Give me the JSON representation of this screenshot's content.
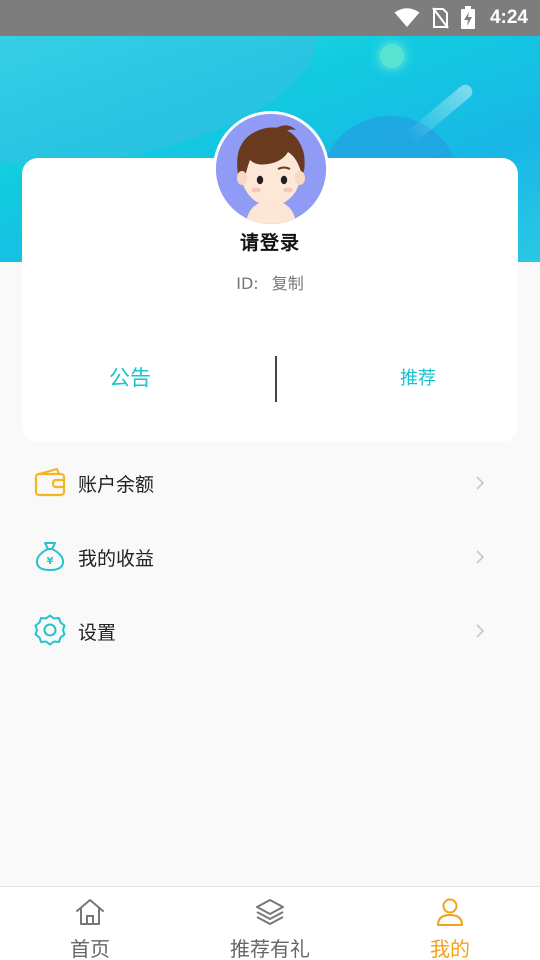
{
  "status_bar": {
    "time": "4:24"
  },
  "profile": {
    "login_prompt": "请登录",
    "id_label": "ID:",
    "copy_label": "复制"
  },
  "card_actions": {
    "notice_label": "公告",
    "recommend_label": "推荐"
  },
  "menu": {
    "items": [
      {
        "label": "账户余额",
        "icon": "wallet-icon"
      },
      {
        "label": "我的收益",
        "icon": "money-bag-icon"
      },
      {
        "label": "设置",
        "icon": "settings-gear-icon"
      }
    ]
  },
  "bottom_nav": {
    "items": [
      {
        "label": "首页",
        "icon": "home-icon",
        "active": false
      },
      {
        "label": "推荐有礼",
        "icon": "layers-icon",
        "active": false
      },
      {
        "label": "我的",
        "icon": "user-icon",
        "active": true
      }
    ]
  },
  "colors": {
    "accent": "#19c3cc",
    "active_nav": "#f2a11b",
    "header_gradient_start": "#2ee3e6",
    "header_gradient_end": "#19b7e6",
    "icon_yellow": "#f6b523",
    "icon_teal": "#22c4cd"
  }
}
